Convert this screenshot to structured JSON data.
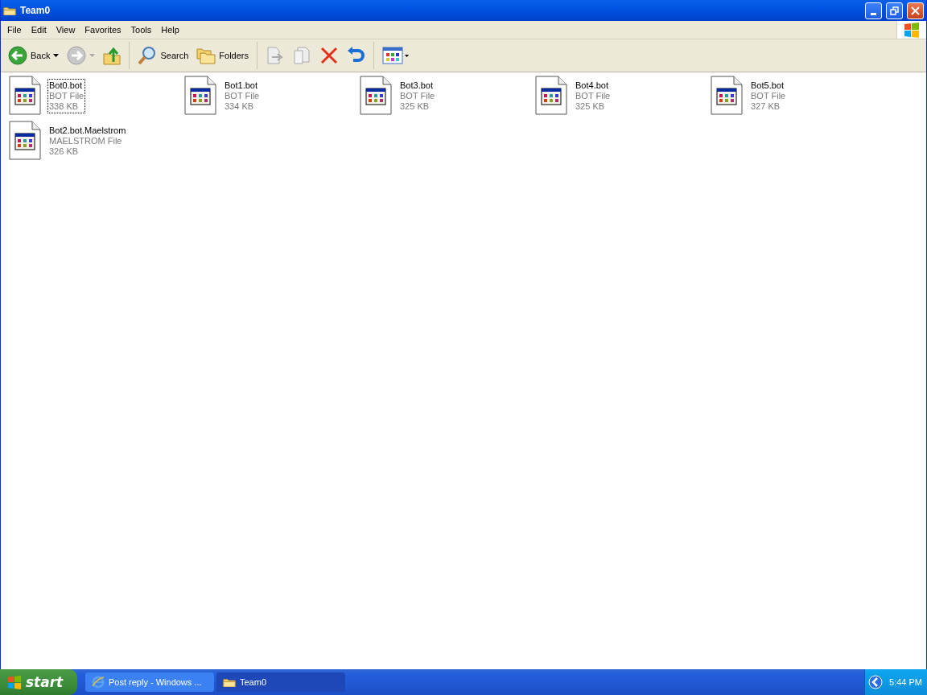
{
  "window": {
    "title": "Team0"
  },
  "menu": [
    "File",
    "Edit",
    "View",
    "Favorites",
    "Tools",
    "Help"
  ],
  "toolbar": [
    {
      "kind": "back",
      "label": "Back"
    },
    {
      "kind": "forward"
    },
    {
      "kind": "up"
    },
    {
      "kind": "search",
      "label": "Search"
    },
    {
      "kind": "folders",
      "label": "Folders"
    },
    {
      "kind": "move"
    },
    {
      "kind": "copy"
    },
    {
      "kind": "delete"
    },
    {
      "kind": "undo"
    },
    {
      "kind": "views"
    }
  ],
  "files": [
    {
      "name": "Bot0.bot",
      "type": "BOT File",
      "size": "338 KB",
      "focused": true
    },
    {
      "name": "Bot1.bot",
      "type": "BOT File",
      "size": "334 KB",
      "focused": false
    },
    {
      "name": "Bot3.bot",
      "type": "BOT File",
      "size": "325 KB",
      "focused": false
    },
    {
      "name": "Bot4.bot",
      "type": "BOT File",
      "size": "325 KB",
      "focused": false
    },
    {
      "name": "Bot5.bot",
      "type": "BOT File",
      "size": "327 KB",
      "focused": false
    },
    {
      "name": "Bot2.bot.Maelstrom",
      "type": "MAELSTROM File",
      "size": "326 KB",
      "focused": false
    }
  ],
  "taskbar": {
    "start": "start",
    "tasks": [
      {
        "kind": "browser",
        "label": "Post reply - Windows ...",
        "selected": false
      },
      {
        "kind": "folder",
        "label": "Team0",
        "selected": true
      }
    ],
    "clock": "5:44 PM"
  }
}
